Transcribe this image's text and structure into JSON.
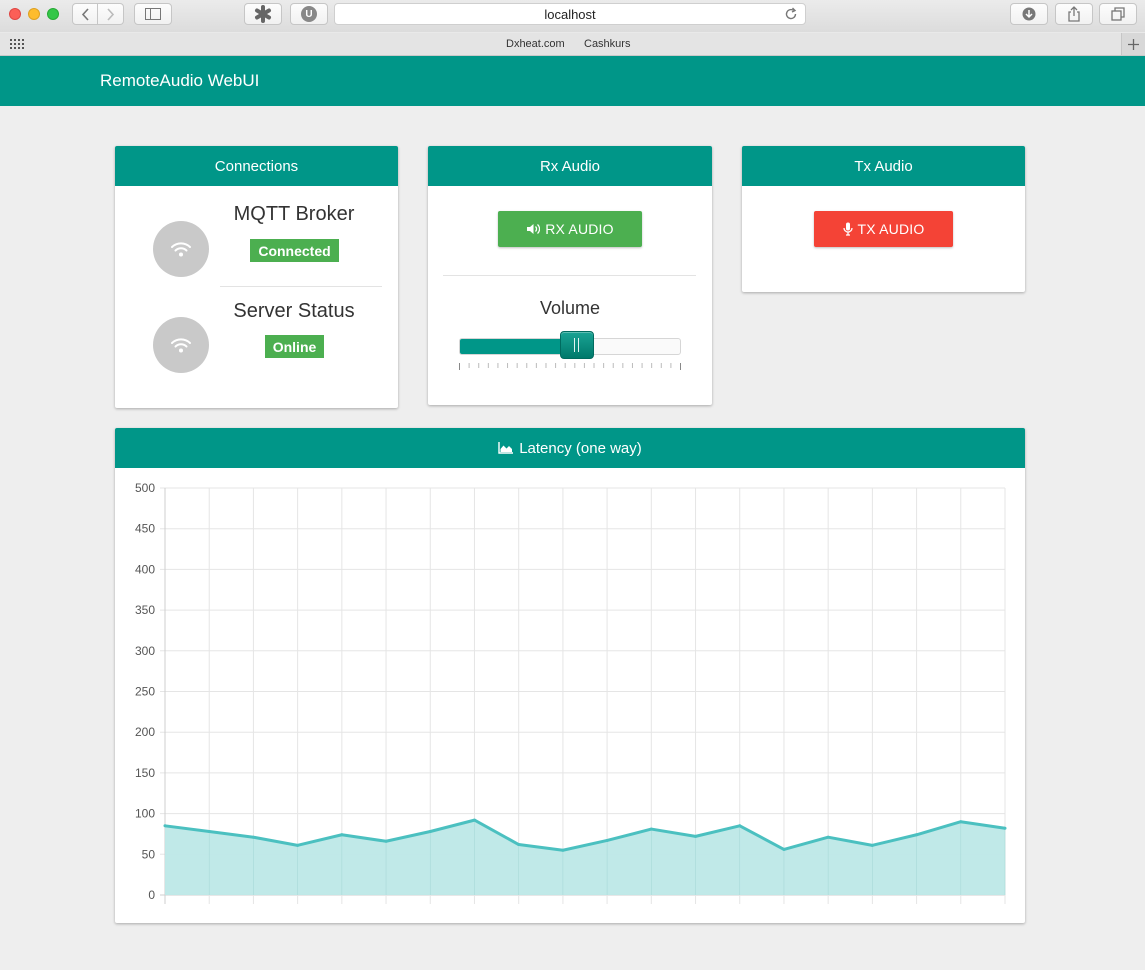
{
  "browser": {
    "url": "localhost",
    "bookmarks": [
      "Dxheat.com",
      "Cashkurs"
    ],
    "extension_label": "U"
  },
  "app": {
    "title": "RemoteAudio WebUI"
  },
  "connections": {
    "title": "Connections",
    "items": [
      {
        "label": "MQTT Broker",
        "status": "Connected"
      },
      {
        "label": "Server Status",
        "status": "Online"
      }
    ]
  },
  "rx": {
    "title": "Rx Audio",
    "button_label": "RX AUDIO",
    "volume_label": "Volume",
    "volume_fraction": 0.53
  },
  "tx": {
    "title": "Tx Audio",
    "button_label": "TX AUDIO"
  },
  "latency": {
    "title": "Latency (one way)",
    "chart_data": {
      "type": "area",
      "ylim": [
        0,
        500
      ],
      "yticks": [
        0,
        50,
        100,
        150,
        200,
        250,
        300,
        350,
        400,
        450,
        500
      ],
      "grid": true,
      "series": [
        {
          "values": [
            85,
            78,
            71,
            61,
            74,
            66,
            78,
            92,
            62,
            55,
            67,
            81,
            72,
            85,
            56,
            71,
            61,
            74,
            90,
            82
          ]
        }
      ],
      "colors": {
        "line": "#4bc0c0",
        "fill": "#bde8e7",
        "grid": "#e5e5e5"
      }
    }
  },
  "colors": {
    "primary": "#009688",
    "success": "#4caf50",
    "danger": "#f44336"
  }
}
